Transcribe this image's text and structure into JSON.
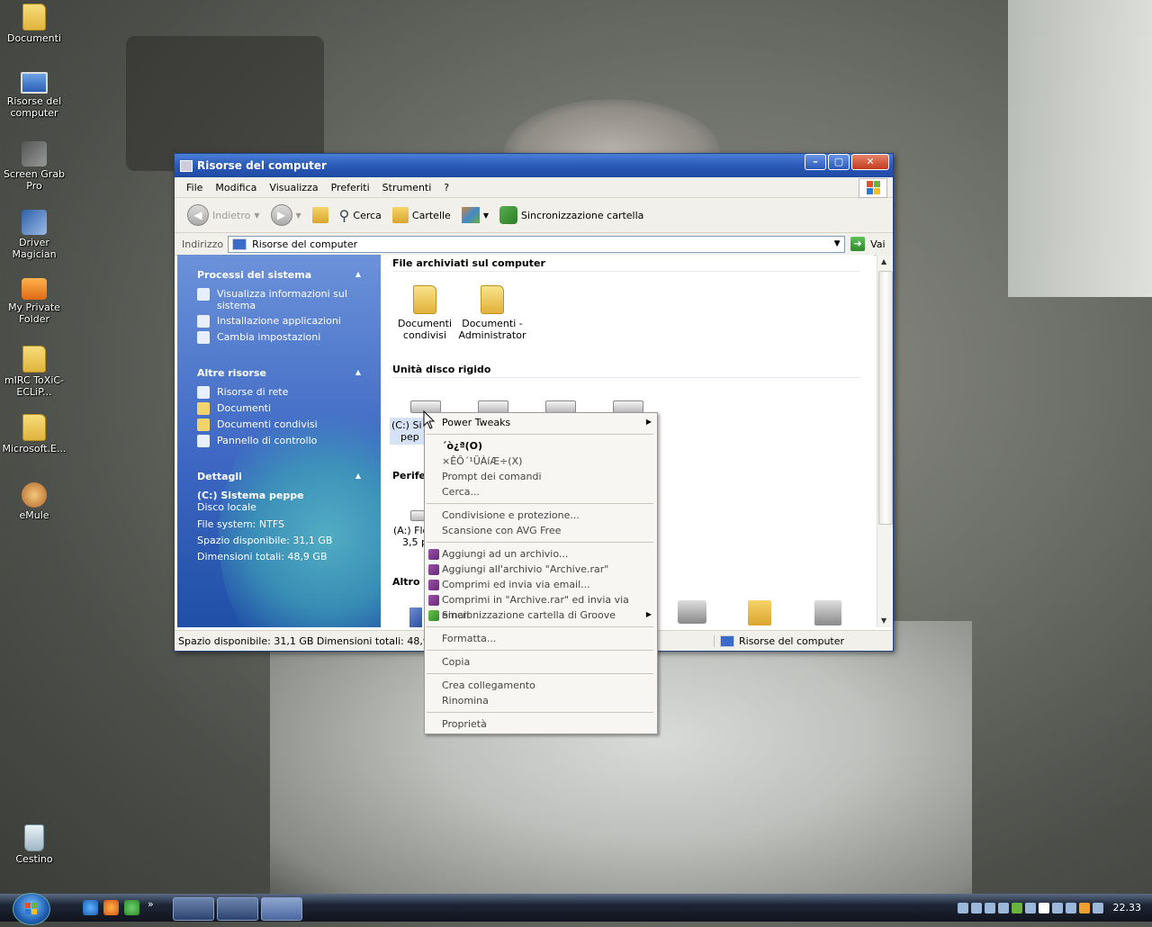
{
  "desktop": {
    "icons": [
      {
        "label": "Documenti",
        "icon": "folder-documents-icon"
      },
      {
        "label": "Risorse del computer",
        "icon": "my-computer-icon"
      },
      {
        "label": "Screen Grab Pro",
        "icon": "screen-grab-icon"
      },
      {
        "label": "Driver Magician",
        "icon": "driver-magician-icon"
      },
      {
        "label": "My Private Folder",
        "icon": "private-folder-icon"
      },
      {
        "label": "mIRC ToXiC-ECLiP...",
        "icon": "folder-icon"
      },
      {
        "label": "Microsoft.E...",
        "icon": "folder-icon"
      },
      {
        "label": "eMule",
        "icon": "emule-icon"
      },
      {
        "label": "Cestino",
        "icon": "recycle-bin-icon"
      }
    ]
  },
  "window": {
    "title": "Risorse del computer",
    "controls": {
      "minimize": "–",
      "maximize": "▢",
      "close": "✕"
    },
    "menu": [
      "File",
      "Modifica",
      "Visualizza",
      "Preferiti",
      "Strumenti",
      "?"
    ],
    "toolbar": {
      "back": "Indietro",
      "search": "Cerca",
      "folders": "Cartelle",
      "sync": "Sincronizzazione cartella"
    },
    "address": {
      "label": "Indirizzo",
      "value": "Risorse del computer",
      "go": "Vai"
    },
    "taskpane": {
      "system": {
        "title": "Processi del sistema",
        "items": [
          "Visualizza informazioni sul sistema",
          "Installazione applicazioni",
          "Cambia impostazioni"
        ]
      },
      "other": {
        "title": "Altre risorse",
        "items": [
          "Risorse di rete",
          "Documenti",
          "Documenti condivisi",
          "Pannello di controllo"
        ]
      },
      "details": {
        "title": "Dettagli",
        "name": "(C:) Sistema peppe",
        "type": "Disco locale",
        "fs": "File system: NTFS",
        "free": "Spazio disponibile: 31,1 GB",
        "total": "Dimensioni totali: 48,9 GB"
      }
    },
    "content": {
      "groups": {
        "files": "File archiviati sul computer",
        "drives": "Unità disco rigido",
        "devices": "Periferi",
        "other": "Altro"
      },
      "files": [
        "Documenti condivisi",
        "Documenti - Administrator"
      ],
      "drive_c": {
        "line1": "(C:) Si",
        "line2": "pep"
      },
      "floppy": {
        "line1": "(A:) Flo",
        "line2": "3,5 p"
      }
    },
    "status": {
      "left": "Spazio disponibile: 31,1 GB Dimensioni totali: 48,9 GB",
      "right": "Risorse del computer"
    }
  },
  "context_menu": {
    "items": [
      {
        "label": "Power Tweaks",
        "submenu": true
      },
      {
        "label": "´ò¿ª(O)",
        "bold": true
      },
      {
        "label": "×ÊÔ´¹ÜÀíÆ÷(X)"
      },
      {
        "label": "Prompt dei comandi"
      },
      {
        "label": "Cerca..."
      },
      {
        "label": "Condivisione e protezione..."
      },
      {
        "label": "Scansione con AVG Free"
      },
      {
        "label": "Aggiungi ad un archivio..."
      },
      {
        "label": "Aggiungi all'archivio \"Archive.rar\""
      },
      {
        "label": "Comprimi ed invia via email..."
      },
      {
        "label": "Comprimi in \"Archive.rar\" ed invia via email"
      },
      {
        "label": "Sincronizzazione cartella di Groove",
        "submenu": true
      },
      {
        "label": "Formatta..."
      },
      {
        "label": "Copia"
      },
      {
        "label": "Crea collegamento"
      },
      {
        "label": "Rinomina"
      },
      {
        "label": "Proprietà"
      }
    ]
  },
  "taskbar": {
    "clock": "22.33",
    "overflow": "»"
  }
}
